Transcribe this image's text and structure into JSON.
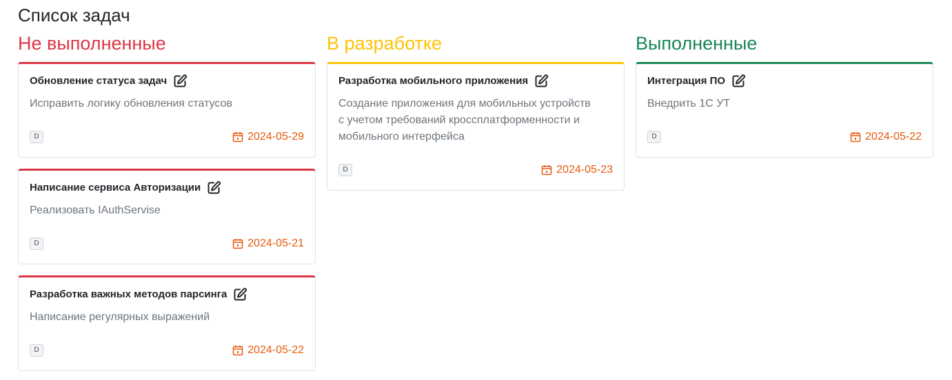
{
  "page": {
    "title": "Список задач"
  },
  "colors": {
    "todo": "#dc3545",
    "in_progress": "#ffc107",
    "done": "#198754",
    "due_date": "#e8590c"
  },
  "columns": [
    {
      "title": "Не выполненные",
      "cards": [
        {
          "title": "Обновление статуса задач",
          "description": "Исправить логику обновления статусов",
          "badge": "D",
          "date": "2024-05-29"
        },
        {
          "title": "Написание сервиса Авторизации",
          "description": "Реализовать IAuthServise",
          "badge": "D",
          "date": "2024-05-21"
        },
        {
          "title": "Разработка важных методов парсинга",
          "description": "Написание регулярных выражений",
          "badge": "D",
          "date": "2024-05-22"
        }
      ]
    },
    {
      "title": "В разработке",
      "cards": [
        {
          "title": "Разработка мобильного приложения",
          "description": "Создание приложения для мобильных устройств с учетом требований кроссплатформенности и мобильного интерфейса",
          "badge": "D",
          "date": "2024-05-23"
        }
      ]
    },
    {
      "title": "Выполненные",
      "cards": [
        {
          "title": "Интеграция ПО",
          "description": "Внедрить 1С УТ",
          "badge": "D",
          "date": "2024-05-22"
        }
      ]
    }
  ],
  "icons": {
    "edit": "edit-icon",
    "calendar": "calendar-icon"
  }
}
